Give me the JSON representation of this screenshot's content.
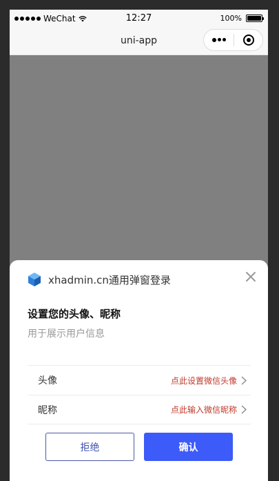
{
  "status_bar": {
    "carrier": "WeChat",
    "time": "12:27",
    "battery_percent_label": "100%",
    "battery_level": 1.0
  },
  "nav": {
    "title": "uni-app",
    "more_icon": "more-dots-icon",
    "close_icon": "target-icon"
  },
  "sheet": {
    "app_title": "xhadmin.cn通用弹窗登录",
    "logo_icon": "cube-logo-icon",
    "heading": "设置您的头像、昵称",
    "subtitle": "用于展示用户信息",
    "rows": [
      {
        "label": "头像",
        "action": "点此设置微信头像"
      },
      {
        "label": "昵称",
        "action": "点此输入微信昵称"
      }
    ],
    "reject_label": "拒绝",
    "confirm_label": "确认"
  },
  "colors": {
    "overlay": "#808080",
    "accent": "#3c5bf8",
    "action_red": "#c0392b",
    "reject_border": "#4a57a6"
  }
}
